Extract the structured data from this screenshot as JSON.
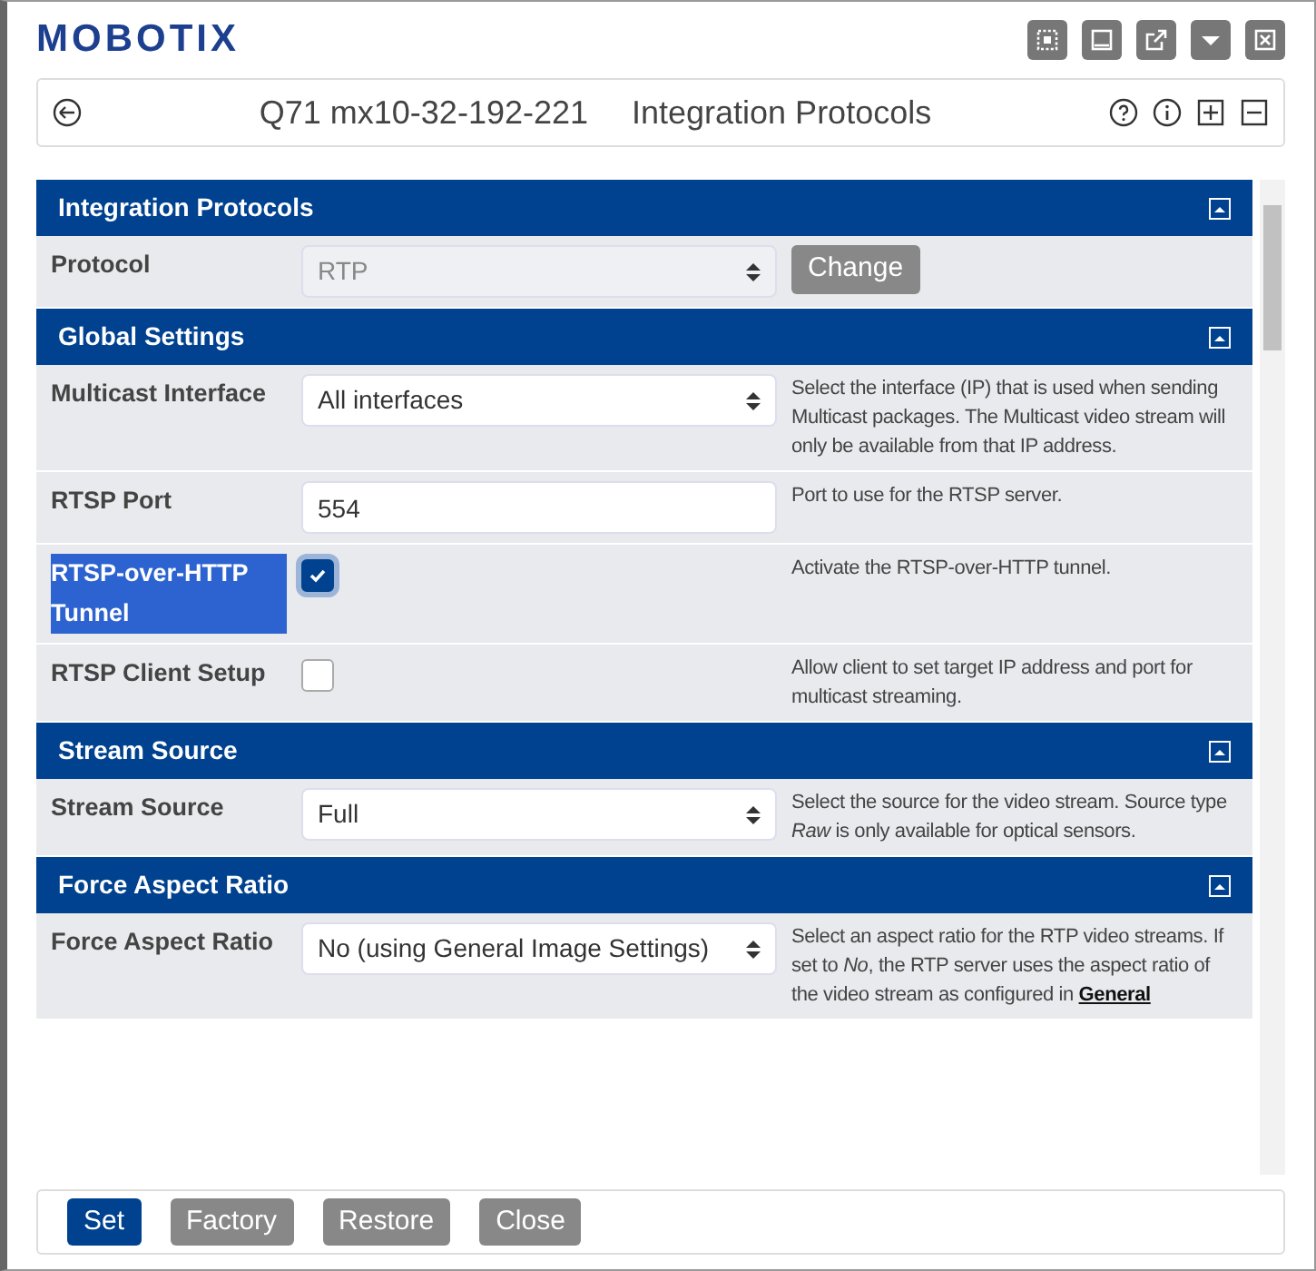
{
  "brand": "MOBOTIX",
  "window_buttons": [
    {
      "kind": "select"
    },
    {
      "kind": "minimize"
    },
    {
      "kind": "popout"
    },
    {
      "kind": "dropdown"
    },
    {
      "kind": "close"
    }
  ],
  "header": {
    "camera": "Q71 mx10-32-192-221",
    "title": "Integration Protocols"
  },
  "sections": [
    {
      "title": "Integration Protocols",
      "rows": [
        {
          "kind": "select",
          "label": "Protocol",
          "value": "RTP",
          "disabled": true,
          "button": "Change"
        }
      ]
    },
    {
      "title": "Global Settings",
      "rows": [
        {
          "kind": "select",
          "label": "Multicast Interface",
          "value": "All interfaces",
          "disabled": false,
          "desc": "Select the interface (IP) that is used when sending Multicast packages. The Multicast video stream will only be available from that IP address."
        },
        {
          "kind": "input",
          "label": "RTSP Port",
          "value": "554",
          "desc": "Port to use for the RTSP server."
        },
        {
          "kind": "checkbox",
          "label": "RTSP-over-HTTP Tunnel",
          "checked": true,
          "highlighted": true,
          "desc": "Activate the RTSP-over-HTTP tunnel."
        },
        {
          "kind": "checkbox",
          "label": "RTSP Client Setup",
          "checked": false,
          "highlighted": false,
          "desc": "Allow client to set target IP address and port for multicast streaming."
        }
      ]
    },
    {
      "title": "Stream Source",
      "rows": [
        {
          "kind": "select",
          "label": "Stream Source",
          "value": "Full",
          "disabled": false,
          "desc": "Select the source for the video stream. Source type *Raw* is only available for optical sensors."
        }
      ]
    },
    {
      "title": "Force Aspect Ratio",
      "rows": [
        {
          "kind": "select",
          "label": "Force Aspect Ratio",
          "value": "No (using General Image Settings)",
          "disabled": false,
          "desc": "Select an aspect ratio for the RTP video streams. If set to *No*, the RTP server uses the aspect ratio of the video stream as configured in",
          "link": "General"
        }
      ]
    }
  ],
  "footer_buttons": [
    {
      "label": "Set",
      "primary": true
    },
    {
      "label": "Factory",
      "primary": false
    },
    {
      "label": "Restore",
      "primary": false
    },
    {
      "label": "Close",
      "primary": false
    }
  ]
}
